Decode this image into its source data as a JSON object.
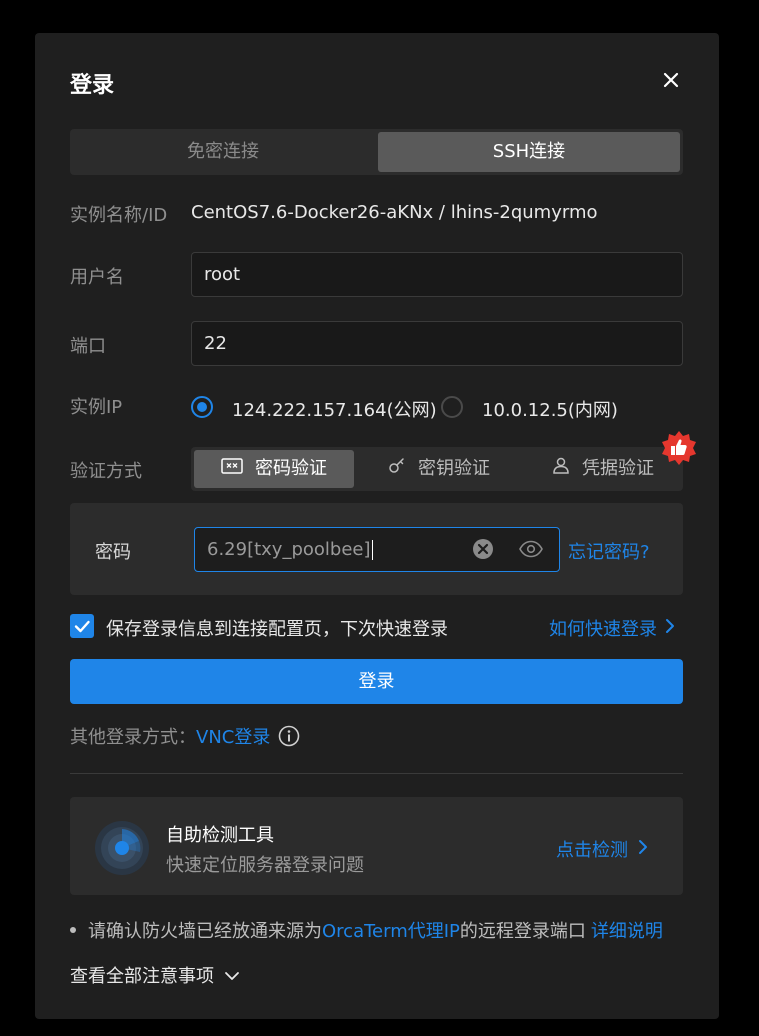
{
  "dialog": {
    "title": "登录"
  },
  "tabs": [
    {
      "label": "免密连接",
      "active": false
    },
    {
      "label": "SSH连接",
      "active": true
    }
  ],
  "instance": {
    "label": "实例名称/ID",
    "value": "CentOS7.6-Docker26-aKNx / lhins-2qumyrmo"
  },
  "username": {
    "label": "用户名",
    "value": "root"
  },
  "port": {
    "label": "端口",
    "value": "22"
  },
  "ip": {
    "label": "实例IP",
    "options": [
      {
        "label": "124.222.157.164(公网)",
        "selected": true
      },
      {
        "label": "10.0.12.5(内网)",
        "selected": false
      }
    ]
  },
  "auth": {
    "label": "验证方式",
    "options": [
      {
        "label": "密码验证",
        "icon": "password-icon",
        "active": true
      },
      {
        "label": "密钥验证",
        "icon": "key-icon",
        "active": false
      },
      {
        "label": "凭据验证",
        "icon": "user-icon",
        "active": false
      }
    ]
  },
  "password": {
    "label": "密码",
    "value": "6.29[txy_poolbee]",
    "forgot": "忘记密码?"
  },
  "remember": {
    "checked": true,
    "label": "保存登录信息到连接配置页，下次快速登录",
    "help_link": "如何快速登录"
  },
  "login_button": "登录",
  "other_login": {
    "prefix": "其他登录方式：",
    "link": "VNC登录"
  },
  "tool": {
    "title": "自助检测工具",
    "subtitle": "快速定位服务器登录问题",
    "action": "点击检测"
  },
  "notice": {
    "text_before": "请确认防火墙已经放通来源为",
    "link_mid": "OrcaTerm代理IP",
    "text_after": "的远程登录端口",
    "link_end": "详细说明"
  },
  "view_all": "查看全部注意事项",
  "colors": {
    "accent": "#1f85e8",
    "badge": "#e5372e",
    "dialog_bg": "#1f1f1f",
    "panel_bg": "#2c2c2c"
  }
}
